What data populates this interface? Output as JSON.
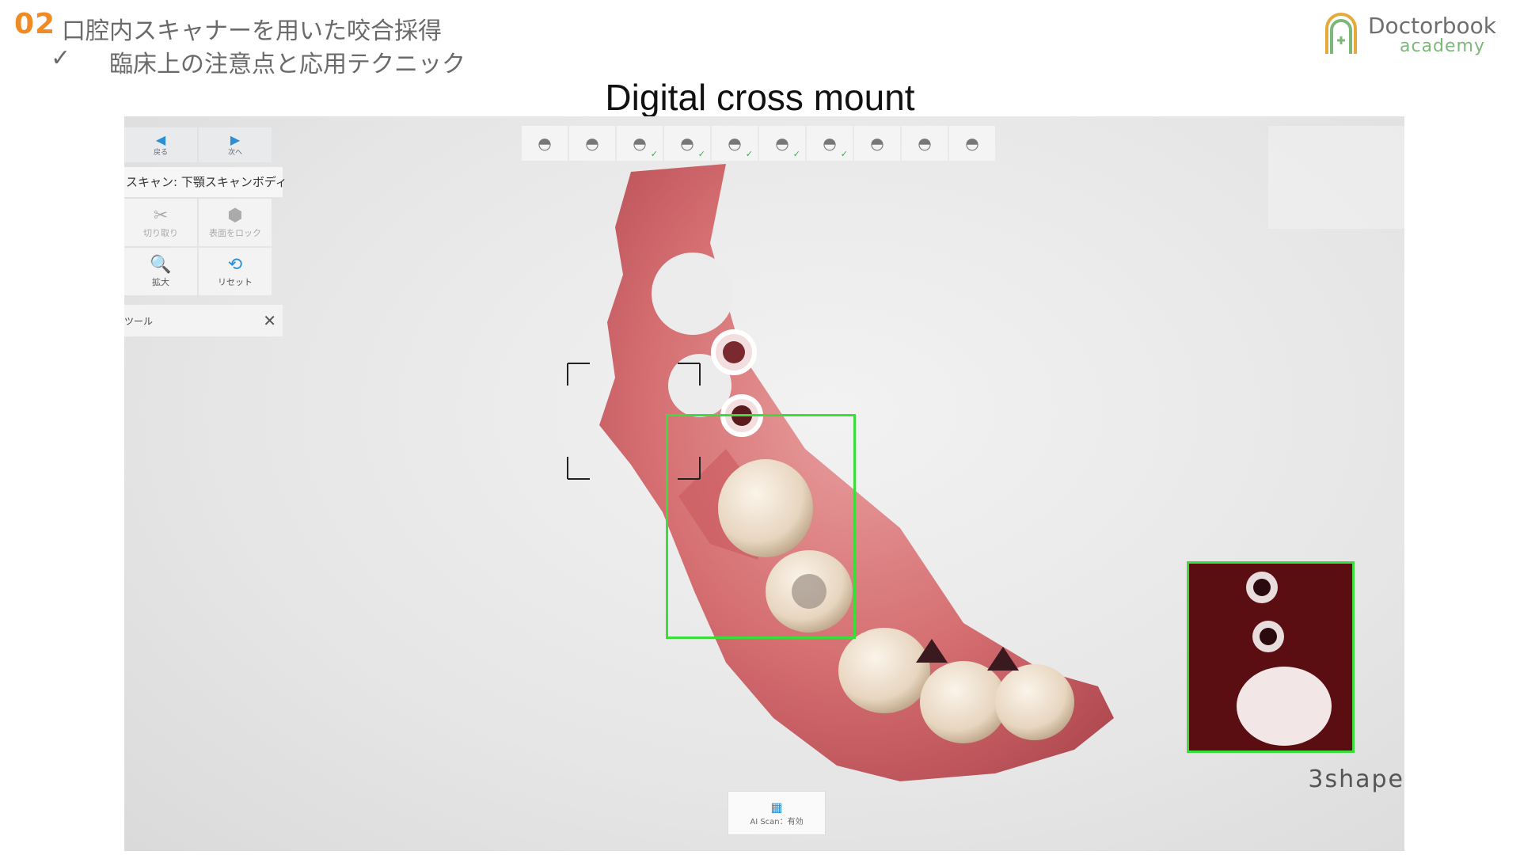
{
  "header": {
    "number": "02",
    "title": "口腔内スキャナーを用いた咬合採得",
    "check": "✓",
    "subtitle": "臨床上の注意点と応用テクニック"
  },
  "logo": {
    "name": "Doctorbook",
    "sub": "academy",
    "color": "#7cb87a"
  },
  "slide_title": "Digital cross mount",
  "app": {
    "nav": {
      "back_label": "戻る",
      "next_label": "次へ"
    },
    "scan_label": "スキャン: 下顎スキャンボディ",
    "tools": [
      {
        "icon": "scissors-icon",
        "glyph": "✂",
        "label": "切り取り",
        "enabled": false
      },
      {
        "icon": "lock-surface-icon",
        "glyph": "⬢",
        "label": "表面をロック",
        "enabled": false
      },
      {
        "icon": "magnifier-icon",
        "glyph": "🔍",
        "label": "拡大",
        "enabled": true
      },
      {
        "icon": "reset-icon",
        "glyph": "⟲",
        "label": "リセット",
        "enabled": true
      }
    ],
    "tools_label": "ツール",
    "workflow_steps": [
      {
        "icon": "patient-icon",
        "done": false
      },
      {
        "icon": "order-form-icon",
        "done": false
      },
      {
        "icon": "upper-jaw-icon",
        "done": true
      },
      {
        "icon": "upper-scanbody-icon",
        "done": true
      },
      {
        "icon": "lower-scanbody-icon",
        "done": true
      },
      {
        "icon": "lower-jaw-icon",
        "done": true
      },
      {
        "icon": "lower-jaw-2-icon",
        "done": true
      },
      {
        "icon": "bite-icon",
        "done": false
      },
      {
        "icon": "occlusion-icon",
        "done": false
      },
      {
        "icon": "send-icon",
        "done": false
      }
    ],
    "ai_scan_label": "AI Scan：有効",
    "brand": "3shape",
    "accent": "#3ddc3d"
  }
}
